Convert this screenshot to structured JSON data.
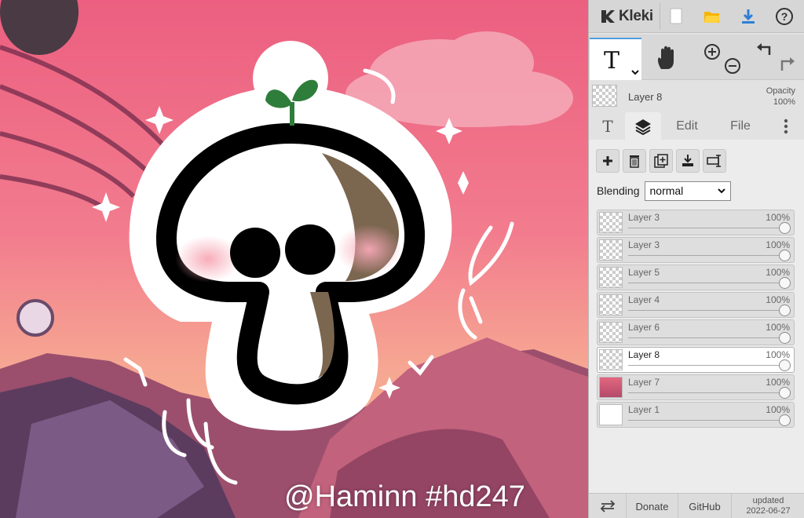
{
  "app": {
    "name": "Kleki"
  },
  "canvas": {
    "watermark": "@Haminn #hd247"
  },
  "topbar": {
    "buttons": [
      {
        "icon": "new-file-icon"
      },
      {
        "icon": "open-folder-icon"
      },
      {
        "icon": "download-icon"
      },
      {
        "icon": "help-icon"
      }
    ]
  },
  "tools": {
    "active": "text-tool"
  },
  "current_layer": {
    "name": "Layer 8",
    "opacity_label": "Opacity",
    "opacity_value": "100%"
  },
  "tabs": {
    "text_tab_icon": "T",
    "edit": "Edit",
    "file": "File"
  },
  "layer_panel": {
    "blending_label": "Blending",
    "blending_value": "normal",
    "layers": [
      {
        "name": "Layer 3",
        "opacity": "100%",
        "selected": false
      },
      {
        "name": "Layer 3",
        "opacity": "100%",
        "selected": false
      },
      {
        "name": "Layer 5",
        "opacity": "100%",
        "selected": false
      },
      {
        "name": "Layer 4",
        "opacity": "100%",
        "selected": false
      },
      {
        "name": "Layer 6",
        "opacity": "100%",
        "selected": false
      },
      {
        "name": "Layer 8",
        "opacity": "100%",
        "selected": true
      },
      {
        "name": "Layer 7",
        "opacity": "100%",
        "selected": false
      },
      {
        "name": "Layer 1",
        "opacity": "100%",
        "selected": false
      }
    ]
  },
  "bottombar": {
    "donate": "Donate",
    "github": "GitHub",
    "updated_label": "updated",
    "updated_date": "2022-06-27"
  },
  "colors": {
    "accent": "#4f9dde",
    "sky_pink": "#ef6a86",
    "sprout_green": "#2f7d3a"
  }
}
